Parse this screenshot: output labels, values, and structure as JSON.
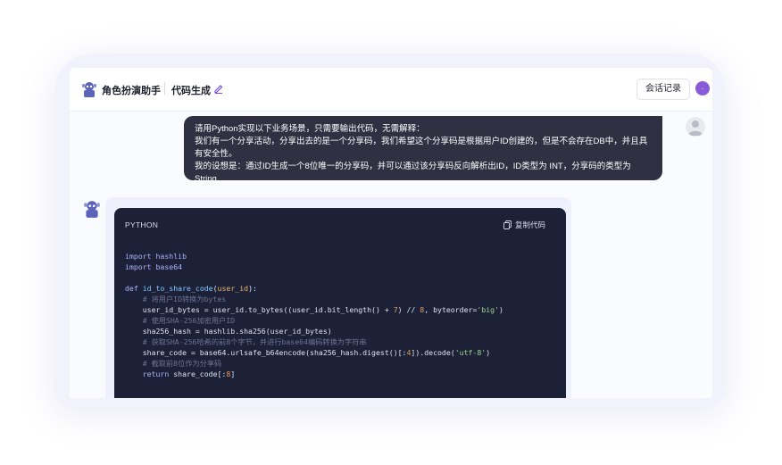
{
  "header": {
    "title": "角色扮演助手",
    "subtitle": "代码生成",
    "history_button": "会话记录"
  },
  "user_message": {
    "lines": [
      "请用Python实现以下业务场景，只需要输出代码，无需解释：",
      "我们有一个分享活动，分享出去的是一个分享码，我们希望这个分享码是根据用户ID创建的，但是不会存在DB中，并且具有安全性。",
      "我的设想是：通过ID生成一个8位唯一的分享码，并可以通过该分享码反向解析出ID，ID类型为 INT，分享码的类型为String"
    ]
  },
  "code_block": {
    "language": "PYTHON",
    "copy_label": "复制代码",
    "lines": {
      "l1": "import hashlib",
      "l2": "import base64",
      "l4_kw": "def",
      "l4_fn": "id_to_share_code",
      "l4_param": "user_id",
      "c1": "# 将用户ID转换为bytes",
      "l6": "user_id_bytes = user_id.to_bytes((user_id.bit_length() + ",
      "l6_num1": "7",
      "l6_mid": ") // ",
      "l6_num2": "8",
      "l6_end": ", byteorder=",
      "l6_str": "'big'",
      "l6_close": ")",
      "c2": "# 使用SHA-256加密用户ID",
      "l8": "sha256_hash = hashlib.sha256(user_id_bytes)",
      "c3": "# 获取SHA-256哈希的前8个字节，并进行base64编码转换为字符串",
      "l10": "share_code = base64.urlsafe_b64encode(sha256_hash.digest()[:",
      "l10_num": "4",
      "l10_mid": "]).decode(",
      "l10_str": "'utf-8'",
      "l10_close": ")",
      "c4": "# 截取前8位作为分享码",
      "l12_kw": "return",
      "l12": " share_code[:",
      "l12_num": "8",
      "l12_close": "]"
    }
  },
  "icons": [
    "robot-icon",
    "edit-icon",
    "user-avatar",
    "copy-icon"
  ],
  "colors": {
    "accent": "#6a4bd6",
    "user_bubble": "#2f3142",
    "code_bg": "#1d2137"
  }
}
